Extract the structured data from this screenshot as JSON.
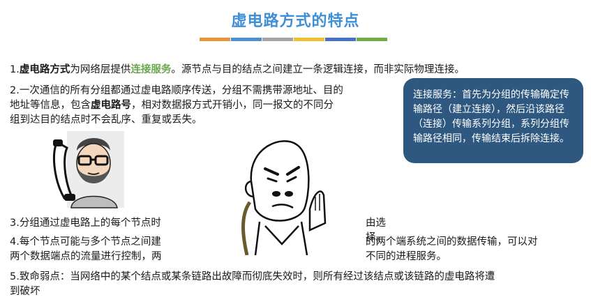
{
  "title": "虚电路方式的特点",
  "colors": {
    "title": "#3f8fd6",
    "accent_green": "#6aa84f",
    "callout_bg": "#2e5880",
    "bars": [
      "#e8953a",
      "#4e90cf",
      "#a5a5a5",
      "#f0c030",
      "#4472c4",
      "#70ad47"
    ]
  },
  "p1": {
    "prefix": "1.",
    "b1": "虚电路方式",
    "t1": "为网络层提供",
    "hl": "连接服务",
    "t2": "。源节点与目的结点之间建立一条逻辑连接，而非实际物理连接。"
  },
  "p2": {
    "l1": "2.一次通信的所有分组都通过虚电路顺序传送，分组不需携带源地址、目的",
    "l2a": "地址等信息，包含",
    "l2b": "虚电路号",
    "l2c": "，相对数据报方式开销小，同一报文的不同分",
    "l3": "组到达目的结点时不会乱序、重复或丢失。"
  },
  "callout": {
    "text": "连接服务：首先为分组的传输确定传输路径（建立连接），然后沿该路径（连接）传输系列分组，系列分组传输路径相同，传输结束后拆除连接。"
  },
  "p3": {
    "left": "3.分组通过虚电路上的每个节点时",
    "right": "由选择。"
  },
  "p4": {
    "l1_left": "4.每个节点可能与多个节点之间建",
    "l1_right": "的两个端系统之间的数据传输，可以对",
    "l2_left": "两个数据端点的流量进行控制，两",
    "l2_right": "不同的进程服务。"
  },
  "p5": {
    "l1": "5.致命弱点：当网络中的某个结点或某条链路出故障而彻底失效时，则所有经过该结点或该链路的虚电路将遭",
    "l2": "到破坏"
  },
  "illustrations": {
    "left": "man-with-glasses-phone",
    "center": "cartoon-monk-thinking"
  }
}
